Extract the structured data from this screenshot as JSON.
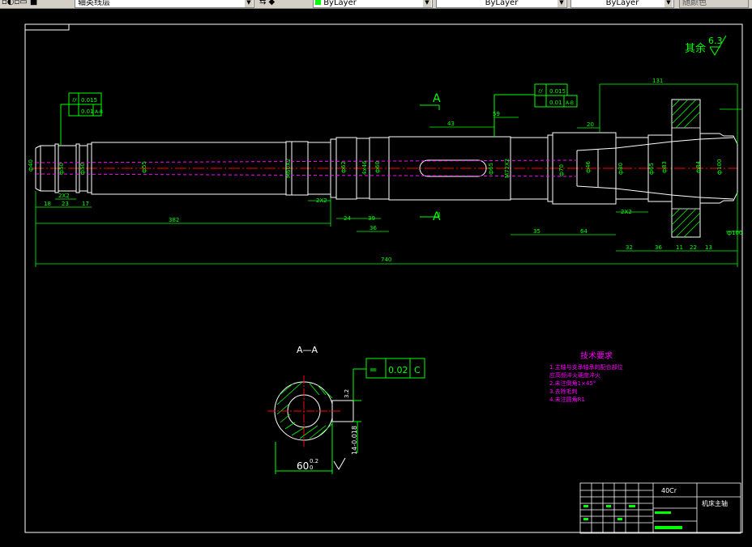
{
  "toolbar": {
    "layer_name": "轴类线层",
    "color_value": "ByLayer",
    "linetype_value": "ByLayer",
    "lineweight_value": "ByLayer",
    "plotstyle_value": "随颜色"
  },
  "drawing": {
    "roughness_label": "其余",
    "roughness_value": "6.3",
    "section_label": "A",
    "section_view_title": "A—A",
    "tolerance_symbol": "═",
    "tolerance_value": "0.02",
    "tolerance_datum": "C",
    "fcf_upper": {
      "value1": "0.015",
      "value2": "0.01",
      "datum": "A-B"
    },
    "fcf_mid": {
      "value1": "0.015",
      "value2": "0.01",
      "datum": "A-B"
    },
    "dims": {
      "d40": "ф40",
      "d50": "ф50",
      "d55": "ф55",
      "d60": "ф60",
      "d62": "ф62",
      "d65": "ф65",
      "d70": "ф70",
      "d80": "ф80",
      "d83": "ф83",
      "d84": "ф84",
      "d100": "ф100",
      "thread_left": "M60X2",
      "thread_mid": "M72X2",
      "spline": "4x46",
      "len_total": "740",
      "len_382": "382",
      "len_131": "131",
      "len_43": "43",
      "len_59": "59",
      "len_20": "20",
      "len_35": "35",
      "len_64": "64",
      "len_32": "32",
      "len_36": "36",
      "len_11": "11",
      "len_22": "22",
      "len_13": "13",
      "len_24": "24",
      "len_39": "39",
      "len_18": "18",
      "len_23": "23",
      "len_17": "17",
      "chamfer": "2X2",
      "sec_60": "60",
      "sec_60_tol_top": "0.2",
      "sec_60_tol_bot": "0",
      "sec_14": "14-0.018"
    },
    "tech_req": {
      "title": "技术要求",
      "line1": "1.主轴与支承轴承的配合部位",
      "line1b": "  应高频淬火硬度淬火",
      "line2": "2.未注倒角1×45°",
      "line3": "3.去除毛刺",
      "line4": "4.未注圆角R1"
    },
    "title_block": {
      "material": "40Cr",
      "part_name": "机床主轴"
    }
  },
  "colors": {
    "outline": "#ffffff",
    "dimension": "#00ff00",
    "center": "#ff0000",
    "hidden": "#ff00ff",
    "hatch": "#00ff00"
  }
}
